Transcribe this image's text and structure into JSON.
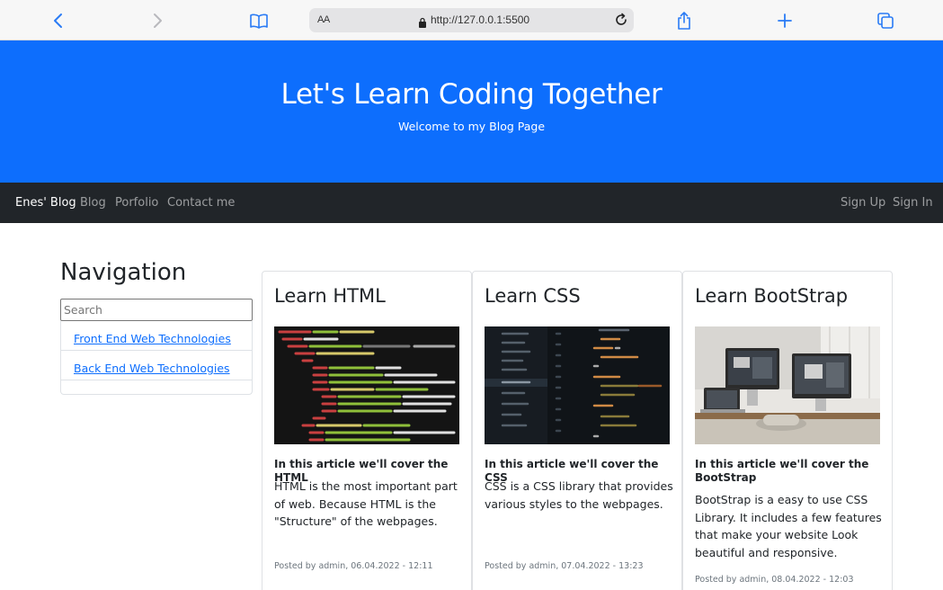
{
  "browser": {
    "text_size_label": "AA",
    "url": "http://127.0.0.1:5500"
  },
  "hero": {
    "title": "Let's Learn Coding Together",
    "subtitle": "Welcome to my Blog Page"
  },
  "navbar": {
    "brand": "Enes' Blog",
    "links": [
      "Blog",
      "Porfolio",
      "Contact me"
    ],
    "sign_up": "Sign Up",
    "sign_in": "Sign In"
  },
  "sidebar": {
    "title": "Navigation",
    "search_placeholder": "Search",
    "items": [
      {
        "label": "Front End Web Technologies"
      },
      {
        "label": "Back End Web Technologies"
      }
    ]
  },
  "cards": [
    {
      "title": "Learn HTML",
      "subtitle": "In this article we'll cover the HTML",
      "text": "HTML is the most important part of web. Because HTML is the \"Structure\" of the webpages.",
      "meta": "Posted by admin, 06.04.2022 - 12:11"
    },
    {
      "title": "Learn CSS",
      "subtitle": "In this article we'll cover the CSS",
      "text": "CSS is a CSS library that provides various styles to the webpages.",
      "meta": "Posted by admin, 07.04.2022 - 13:23"
    },
    {
      "title": "Learn BootStrap",
      "subtitle": "In this article we'll cover the BootStrap",
      "text": "BootStrap is a easy to use CSS Library. It includes a few features that make your website Look beautiful and responsive.",
      "meta": "Posted by admin, 08.04.2022 - 12:03"
    }
  ],
  "colors": {
    "hero_bg": "#0d6efd",
    "navbar_bg": "#212529",
    "link": "#0d6efd"
  },
  "icons": [
    "back-icon",
    "forward-icon",
    "book-icon",
    "lock-icon",
    "reload-icon",
    "share-icon",
    "plus-icon",
    "tabs-icon"
  ]
}
